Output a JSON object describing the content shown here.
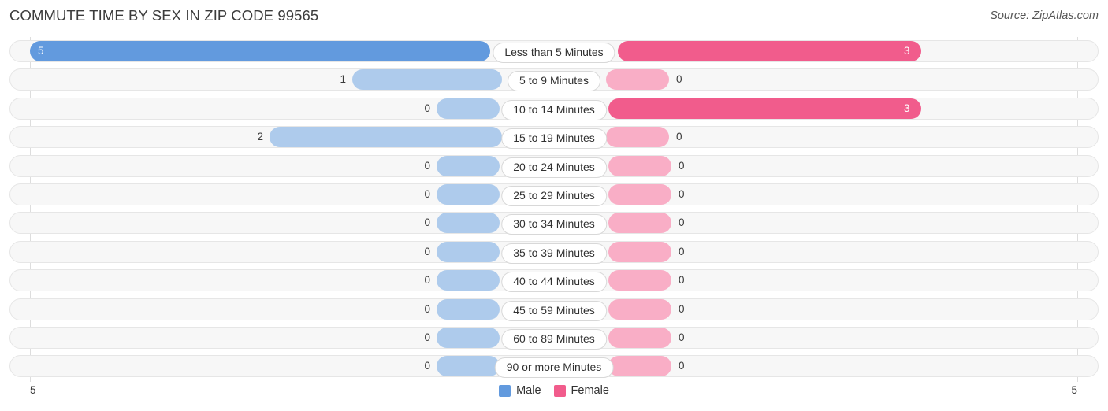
{
  "header": {
    "title": "COMMUTE TIME BY SEX IN ZIP CODE 99565",
    "source": "Source: ZipAtlas.com"
  },
  "legend": {
    "male_label": "Male",
    "female_label": "Female",
    "male_color": "#629ade",
    "female_color": "#f15c8c"
  },
  "axis": {
    "left_tick": "5",
    "right_tick": "5"
  },
  "chart_data": {
    "type": "bar",
    "orientation": "horizontal-diverging",
    "title": "COMMUTE TIME BY SEX IN ZIP CODE 99565",
    "xlabel": "",
    "ylabel": "",
    "xlim": [
      5,
      5
    ],
    "grid": false,
    "legend_position": "bottom-center",
    "categories": [
      "Less than 5 Minutes",
      "5 to 9 Minutes",
      "10 to 14 Minutes",
      "15 to 19 Minutes",
      "20 to 24 Minutes",
      "25 to 29 Minutes",
      "30 to 34 Minutes",
      "35 to 39 Minutes",
      "40 to 44 Minutes",
      "45 to 59 Minutes",
      "60 to 89 Minutes",
      "90 or more Minutes"
    ],
    "series": [
      {
        "name": "Male",
        "direction": "left",
        "values": [
          5,
          1,
          0,
          2,
          0,
          0,
          0,
          0,
          0,
          0,
          0,
          0
        ],
        "labels": [
          "5",
          "1",
          "0",
          "2",
          "0",
          "0",
          "0",
          "0",
          "0",
          "0",
          "0",
          "0"
        ]
      },
      {
        "name": "Female",
        "direction": "right",
        "values": [
          3,
          0,
          3,
          0,
          0,
          0,
          0,
          0,
          0,
          0,
          0,
          0
        ],
        "labels": [
          "3",
          "0",
          "3",
          "0",
          "0",
          "0",
          "0",
          "0",
          "0",
          "0",
          "0",
          "0"
        ]
      }
    ]
  },
  "rows": [
    {
      "label": "Less than 5 Minutes",
      "male": {
        "value": "5",
        "start": 38,
        "end": 622,
        "inside": true,
        "faded": false
      },
      "female": {
        "value": "3",
        "start": 784,
        "end": 1169,
        "inside": true,
        "faded": false
      }
    },
    {
      "label": "5 to 9 Minutes",
      "male": {
        "value": "1",
        "start": 447,
        "end": 637,
        "inside": false,
        "faded": true
      },
      "female": {
        "value": "0",
        "start": 769,
        "end": 849,
        "inside": false,
        "faded": true
      }
    },
    {
      "label": "10 to 14 Minutes",
      "male": {
        "value": "0",
        "start": 554,
        "end": 634,
        "inside": false,
        "faded": true
      },
      "female": {
        "value": "3",
        "start": 772,
        "end": 1169,
        "inside": true,
        "faded": false
      }
    },
    {
      "label": "15 to 19 Minutes",
      "male": {
        "value": "2",
        "start": 342,
        "end": 637,
        "inside": false,
        "faded": true
      },
      "female": {
        "value": "0",
        "start": 769,
        "end": 849,
        "inside": false,
        "faded": true
      }
    },
    {
      "label": "20 to 24 Minutes",
      "male": {
        "value": "0",
        "start": 554,
        "end": 634,
        "inside": false,
        "faded": true
      },
      "female": {
        "value": "0",
        "start": 772,
        "end": 852,
        "inside": false,
        "faded": true
      }
    },
    {
      "label": "25 to 29 Minutes",
      "male": {
        "value": "0",
        "start": 554,
        "end": 634,
        "inside": false,
        "faded": true
      },
      "female": {
        "value": "0",
        "start": 772,
        "end": 852,
        "inside": false,
        "faded": true
      }
    },
    {
      "label": "30 to 34 Minutes",
      "male": {
        "value": "0",
        "start": 554,
        "end": 634,
        "inside": false,
        "faded": true
      },
      "female": {
        "value": "0",
        "start": 772,
        "end": 852,
        "inside": false,
        "faded": true
      }
    },
    {
      "label": "35 to 39 Minutes",
      "male": {
        "value": "0",
        "start": 554,
        "end": 634,
        "inside": false,
        "faded": true
      },
      "female": {
        "value": "0",
        "start": 772,
        "end": 852,
        "inside": false,
        "faded": true
      }
    },
    {
      "label": "40 to 44 Minutes",
      "male": {
        "value": "0",
        "start": 554,
        "end": 634,
        "inside": false,
        "faded": true
      },
      "female": {
        "value": "0",
        "start": 772,
        "end": 852,
        "inside": false,
        "faded": true
      }
    },
    {
      "label": "45 to 59 Minutes",
      "male": {
        "value": "0",
        "start": 554,
        "end": 634,
        "inside": false,
        "faded": true
      },
      "female": {
        "value": "0",
        "start": 772,
        "end": 852,
        "inside": false,
        "faded": true
      }
    },
    {
      "label": "60 to 89 Minutes",
      "male": {
        "value": "0",
        "start": 554,
        "end": 634,
        "inside": false,
        "faded": true
      },
      "female": {
        "value": "0",
        "start": 772,
        "end": 852,
        "inside": false,
        "faded": true
      }
    },
    {
      "label": "90 or more Minutes",
      "male": {
        "value": "0",
        "start": 554,
        "end": 634,
        "inside": false,
        "faded": true
      },
      "female": {
        "value": "0",
        "start": 772,
        "end": 852,
        "inside": false,
        "faded": true
      }
    }
  ]
}
